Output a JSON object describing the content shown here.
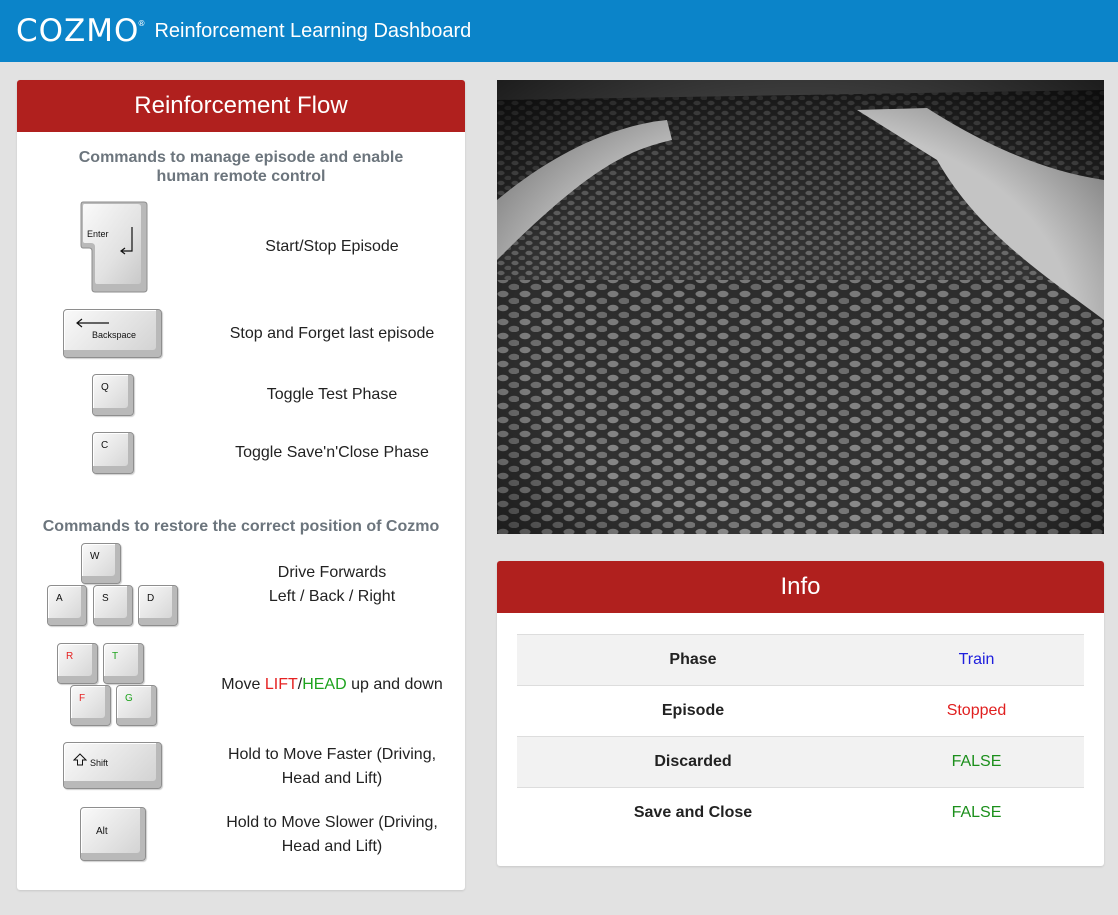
{
  "header": {
    "logo": "COZMO",
    "logo_mark": "®",
    "title": "Reinforcement Learning Dashboard"
  },
  "flow": {
    "title": "Reinforcement Flow",
    "section1": "Commands to manage episode and enable human remote control",
    "section2": "Commands to restore the correct position of Cozmo",
    "keys": {
      "enter": "Enter",
      "backspace": "Backspace",
      "q": "Q",
      "c": "C",
      "w": "W",
      "a": "A",
      "s": "S",
      "d": "D",
      "r": "R",
      "t": "T",
      "f": "F",
      "g": "G",
      "shift": "Shift",
      "alt": "Alt"
    },
    "commands": {
      "start_stop": "Start/Stop Episode",
      "stop_forget": "Stop and Forget last episode",
      "toggle_test": "Toggle Test Phase",
      "toggle_save": "Toggle Save'n'Close Phase",
      "drive_line1": "Drive Forwards",
      "drive_line2": "Left / Back / Right",
      "move_prefix": "Move ",
      "move_lift": "LIFT",
      "move_slash": "/",
      "move_head": "HEAD",
      "move_suffix": " up and down",
      "faster": "Hold to Move Faster (Driving, Head and Lift)",
      "slower": "Hold to Move Slower (Driving, Head and Lift)"
    }
  },
  "info": {
    "title": "Info",
    "rows": [
      {
        "label": "Phase",
        "value": "Train",
        "color": "#2020dd"
      },
      {
        "label": "Episode",
        "value": "Stopped",
        "color": "#e01f1f"
      },
      {
        "label": "Discarded",
        "value": "FALSE",
        "color": "#1b8f1b"
      },
      {
        "label": "Save and Close",
        "value": "FALSE",
        "color": "#1b8f1b"
      }
    ]
  },
  "colors": {
    "topbar": "#0b84c9",
    "card_header": "#b0201e",
    "lift": "#e52222",
    "head": "#1ea31e"
  }
}
